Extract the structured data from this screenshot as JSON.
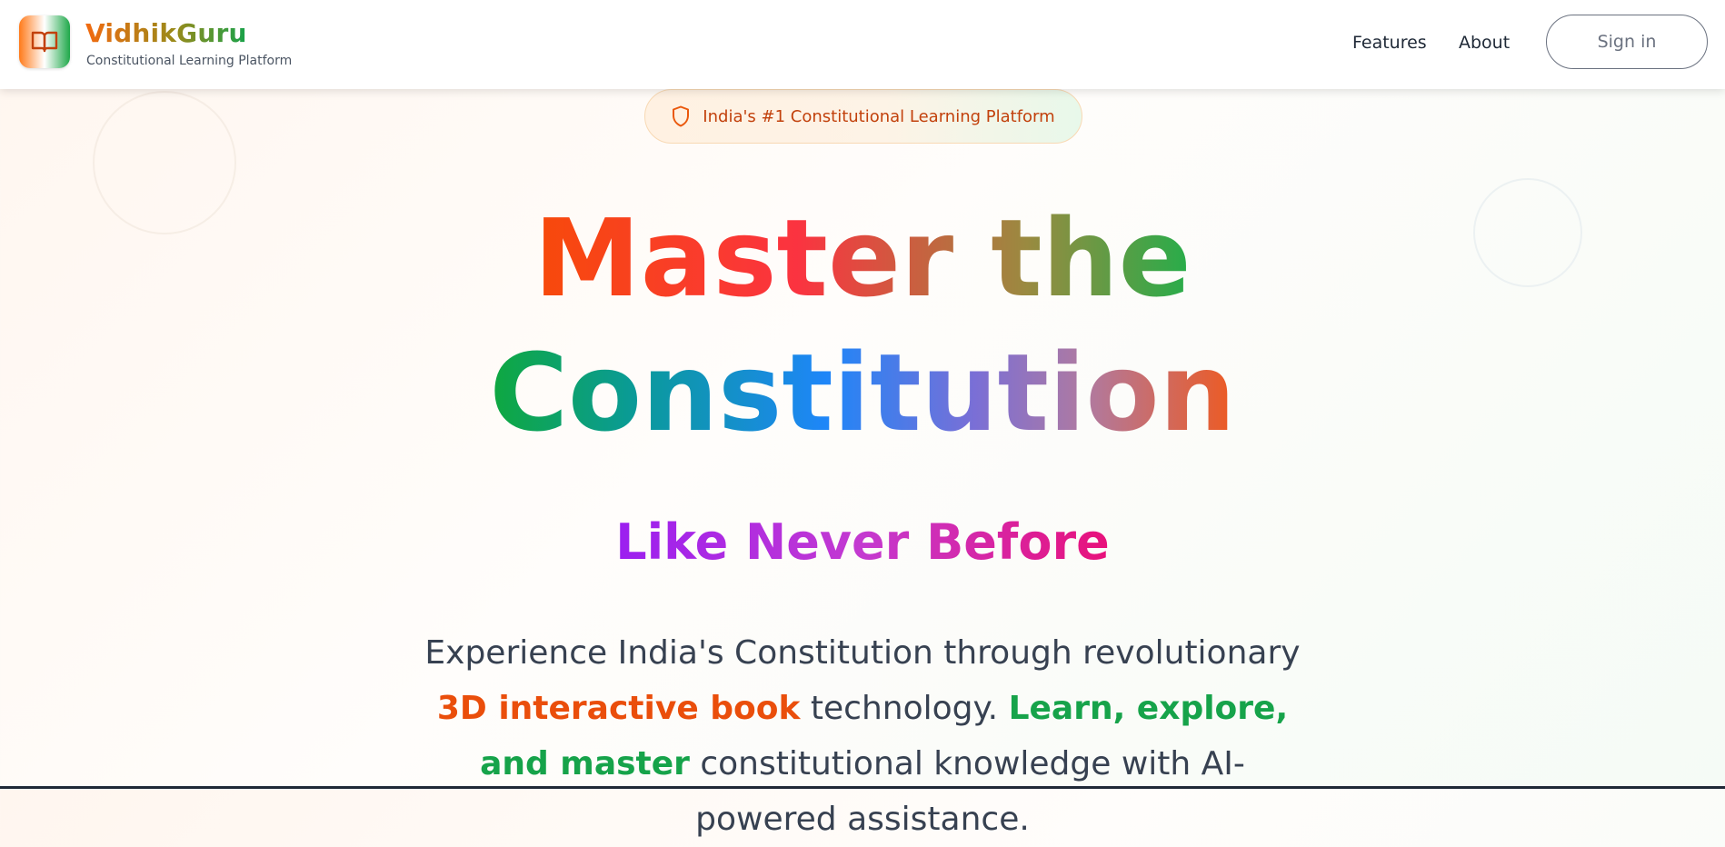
{
  "brand": {
    "name": "VidhikGuru",
    "subtitle": "Constitutional Learning Platform",
    "logo_icon": "open-book-icon"
  },
  "nav": {
    "links": [
      "Features",
      "About"
    ],
    "signin_label": "Sign in"
  },
  "hero": {
    "badge_icon": "shield-icon",
    "badge_text": "India's #1 Constitutional Learning Platform",
    "headline_line1": "Master the",
    "headline_line2": "Constitution",
    "tagline": "Like Never Before",
    "description": {
      "part1": "Experience India's Constitution through revolutionary ",
      "highlight1": "3D interactive book",
      "part2": " technology. ",
      "highlight2": "Learn, explore, and master",
      "part3": " constitutional knowledge with AI-powered assistance."
    }
  },
  "colors": {
    "saffron": "#f26a10",
    "green": "#16a34a",
    "text": "#374151",
    "tagline_start": "#9b1ff0",
    "tagline_end": "#e8117a"
  }
}
